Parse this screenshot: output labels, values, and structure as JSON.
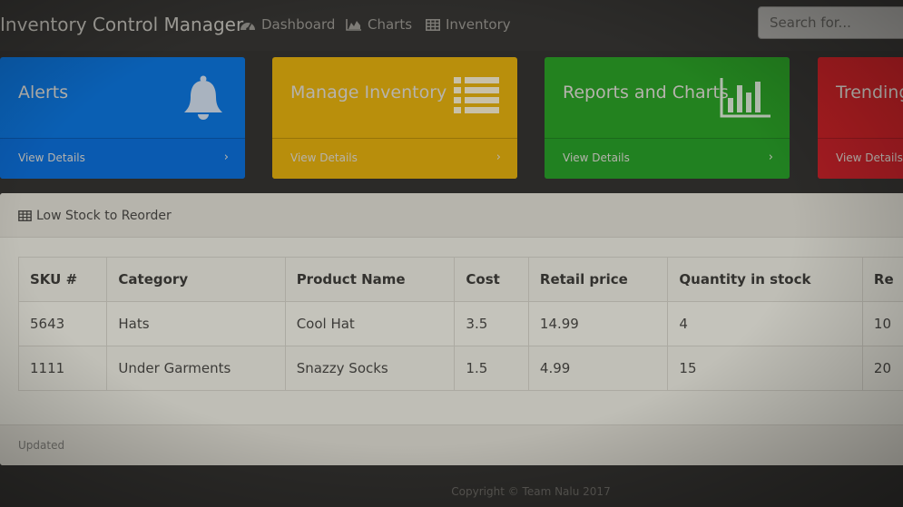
{
  "navbar": {
    "brand": "Inventory Control Manager",
    "links": [
      {
        "label": "Dashboard",
        "icon": "dashboard-icon"
      },
      {
        "label": "Charts",
        "icon": "area-chart-icon"
      },
      {
        "label": "Inventory",
        "icon": "table-icon"
      }
    ],
    "search_placeholder": "Search for..."
  },
  "cards": [
    {
      "title": "Alerts",
      "footer": "View Details",
      "icon": "bell-icon",
      "color": "#0a5fb3"
    },
    {
      "title": "Manage Inventory",
      "footer": "View Details",
      "icon": "list-icon",
      "color": "#b98f0c"
    },
    {
      "title": "Reports and Charts",
      "footer": "View Details",
      "icon": "bar-chart-icon",
      "color": "#23821f"
    },
    {
      "title": "Trending",
      "footer": "View Details",
      "icon": "",
      "color": "#a71c20"
    }
  ],
  "panel": {
    "title": "Low Stock to Reorder",
    "icon": "table-icon",
    "columns": [
      "SKU #",
      "Category",
      "Product Name",
      "Cost",
      "Retail price",
      "Quantity in stock",
      "Re"
    ],
    "rows": [
      [
        "5643",
        "Hats",
        "Cool Hat",
        "3.5",
        "14.99",
        "4",
        "10"
      ],
      [
        "1111",
        "Under Garments",
        "Snazzy Socks",
        "1.5",
        "4.99",
        "15",
        "20"
      ]
    ],
    "footer": "Updated"
  },
  "copyright": "Copyright © Team Nalu 2017"
}
